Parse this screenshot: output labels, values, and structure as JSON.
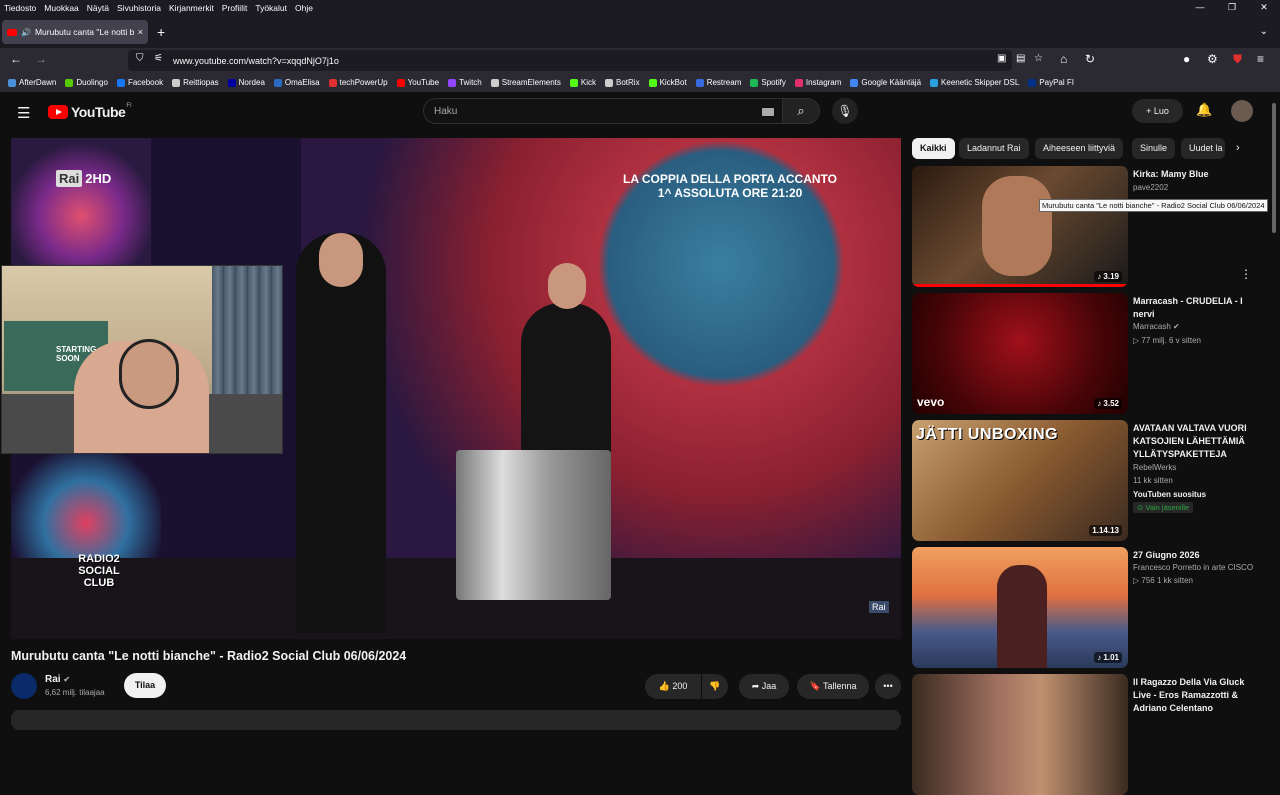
{
  "menu": [
    "Tiedosto",
    "Muokkaa",
    "Näytä",
    "Sivuhistoria",
    "Kirjanmerkit",
    "Profiilit",
    "Työkalut",
    "Ohje"
  ],
  "tab": {
    "title": "Murubutu canta \"Le notti b",
    "close": "×",
    "new": "+"
  },
  "address": {
    "url": "www.youtube.com/watch?v=xqqdNjO7j1o"
  },
  "bookmarks": [
    {
      "label": "AfterDawn",
      "color": "#4a90d9"
    },
    {
      "label": "Duolingo",
      "color": "#58cc02"
    },
    {
      "label": "Facebook",
      "color": "#1877f2"
    },
    {
      "label": "Reittiopas",
      "color": "#cccccc"
    },
    {
      "label": "Nordea",
      "color": "#0000a0"
    },
    {
      "label": "OmaElisa",
      "color": "#2a6ac0"
    },
    {
      "label": "techPowerUp",
      "color": "#e03030"
    },
    {
      "label": "YouTube",
      "color": "#ff0000"
    },
    {
      "label": "Twitch",
      "color": "#9146ff"
    },
    {
      "label": "StreamElements",
      "color": "#cccccc"
    },
    {
      "label": "Kick",
      "color": "#53fc18"
    },
    {
      "label": "BotRix",
      "color": "#cccccc"
    },
    {
      "label": "KickBot",
      "color": "#53fc18"
    },
    {
      "label": "Restream",
      "color": "#3a6ae0"
    },
    {
      "label": "Spotify",
      "color": "#1db954"
    },
    {
      "label": "Instagram",
      "color": "#e1306c"
    },
    {
      "label": "Google Kääntäjä",
      "color": "#4285f4"
    },
    {
      "label": "Keenetic Skipper DSL",
      "color": "#2aa0e0"
    },
    {
      "label": "PayPal FI",
      "color": "#003087"
    }
  ],
  "yt": {
    "logo": "YouTube",
    "region": "FI",
    "search_placeholder": "Haku",
    "create_label": "Luo"
  },
  "video": {
    "title": "Murubutu canta \"Le notti bianche\" - Radio2 Social Club 06/06/2024",
    "overlay_line1": "LA COPPIA DELLA PORTA ACCANTO",
    "overlay_line2": "1^ ASSOLUTA ORE 21:20",
    "channel_bug": "Rai",
    "channel_bug_suffix": "2HD",
    "social_logo": "RADIO2 SOCIAL CLUB",
    "corner_bug": "Rai",
    "cam_poster": "STARTING SOON"
  },
  "channel": {
    "name": "Rai",
    "subs": "6,62 milj. tilaajaa",
    "subscribe": "Tilaa"
  },
  "actions": {
    "likes": "200",
    "share": "Jaa",
    "save": "Tallenna"
  },
  "chips": [
    "Kaikki",
    "Ladannut Rai",
    "Aiheeseen liittyviä",
    "Sinulle",
    "Uudet la"
  ],
  "tooltip": "Murubutu canta \"Le notti bianche\" - Radio2 Social Club 06/06/2024",
  "recommendations": [
    {
      "title": "Kirka: Mamy Blue",
      "channel": "pave2202",
      "meta": "",
      "duration": "3.19"
    },
    {
      "title": "Marracash - CRUDELIA - I nervi",
      "channel": "Marracash",
      "meta": "77 milj.  6 v sitten",
      "duration": "3.52",
      "thumb_label": "vevo"
    },
    {
      "title": "AVATAAN VALTAVA VUORI KATSOJIEN LÄHETTÄMIÄ YLLÄTYSPAKETTEJA",
      "channel": "RebelWerks",
      "meta": "11 kk sitten",
      "extra": "YouTuben suositus",
      "badge": "Vain jäsenille",
      "duration": "1.14.13",
      "thumb_label": "JÄTTI UNBOXING"
    },
    {
      "title": "27 Giugno 2026",
      "channel": "Francesco Porretto in arte CISCO",
      "meta": "756  1 kk sitten",
      "duration": "1.01"
    },
    {
      "title": "Il Ragazzo Della Via Gluck Live - Eros Ramazzotti & Adriano Celentano",
      "channel": "",
      "meta": "",
      "duration": ""
    }
  ]
}
